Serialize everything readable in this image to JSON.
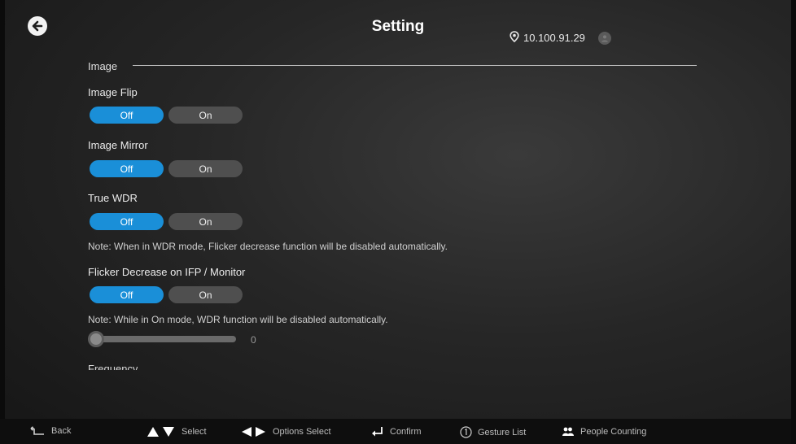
{
  "header": {
    "title": "Setting",
    "ip_address": "10.100.91.29",
    "icons": [
      "back-arrow-icon",
      "location-pin-icon",
      "user-avatar-icon"
    ]
  },
  "image_section": {
    "label": "Image",
    "settings": [
      {
        "label": "Image Flip",
        "off_label": "Off",
        "on_label": "On",
        "selected": "Off"
      },
      {
        "label": "Image Mirror",
        "off_label": "Off",
        "on_label": "On",
        "selected": "Off"
      },
      {
        "label": "True WDR",
        "off_label": "Off",
        "on_label": "On",
        "selected": "Off",
        "note": "Note: When in WDR mode, Flicker decrease function will be disabled automatically."
      },
      {
        "label": "Flicker Decrease on IFP / Monitor",
        "off_label": "Off",
        "on_label": "On",
        "selected": "Off",
        "note": "Note: While in On mode, WDR function will be disabled automatically."
      }
    ],
    "slider": {
      "value": "0"
    },
    "next_label": "Frequency"
  },
  "bottom_bar": {
    "hints": [
      {
        "icon": "back-icon",
        "label": "Back"
      },
      {
        "icon": "up-down-arrows-icon",
        "label": "Select"
      },
      {
        "icon": "left-right-arrows-icon",
        "label": "Options Select"
      },
      {
        "icon": "enter-icon",
        "label": "Confirm"
      },
      {
        "icon": "number-one-circle-icon",
        "label": "Gesture List"
      },
      {
        "icon": "people-counting-icon",
        "label": "People Counting"
      }
    ]
  },
  "colors": {
    "accent": "#1a8fd8",
    "inactive_toggle": "#4f4f4f",
    "background": "#262626"
  }
}
